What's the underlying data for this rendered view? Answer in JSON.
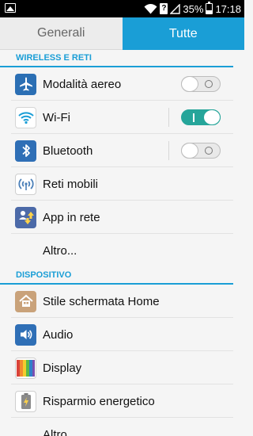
{
  "status_bar": {
    "battery": "35%",
    "time": "17:18",
    "icons": [
      "image-icon",
      "wifi-icon",
      "notification-badge-icon",
      "signal-icon",
      "battery-icon"
    ]
  },
  "tabs": {
    "general": "Generali",
    "all": "Tutte",
    "active": "Tutte",
    "accent_color": "#1a9ed6"
  },
  "sections": {
    "wireless": {
      "title": "WIRELESS E RETI",
      "items": {
        "airplane": {
          "label": "Modalità aereo",
          "toggle": "off",
          "icon": "airplane-icon"
        },
        "wifi": {
          "label": "Wi-Fi",
          "toggle": "on",
          "icon": "wifi-icon"
        },
        "bluetooth": {
          "label": "Bluetooth",
          "toggle": "off",
          "icon": "bluetooth-icon"
        },
        "mobile": {
          "label": "Reti mobili",
          "icon": "mobile-network-icon"
        },
        "tethering": {
          "label": "App in rete",
          "icon": "tethering-icon"
        },
        "more": {
          "label": "Altro..."
        }
      }
    },
    "device": {
      "title": "DISPOSITIVO",
      "items": {
        "home": {
          "label": "Stile schermata Home",
          "icon": "home-style-icon"
        },
        "audio": {
          "label": "Audio",
          "icon": "audio-icon"
        },
        "display": {
          "label": "Display",
          "icon": "display-icon"
        },
        "power": {
          "label": "Risparmio energetico",
          "icon": "battery-saver-icon"
        },
        "more": {
          "label": "Altro"
        }
      }
    }
  }
}
